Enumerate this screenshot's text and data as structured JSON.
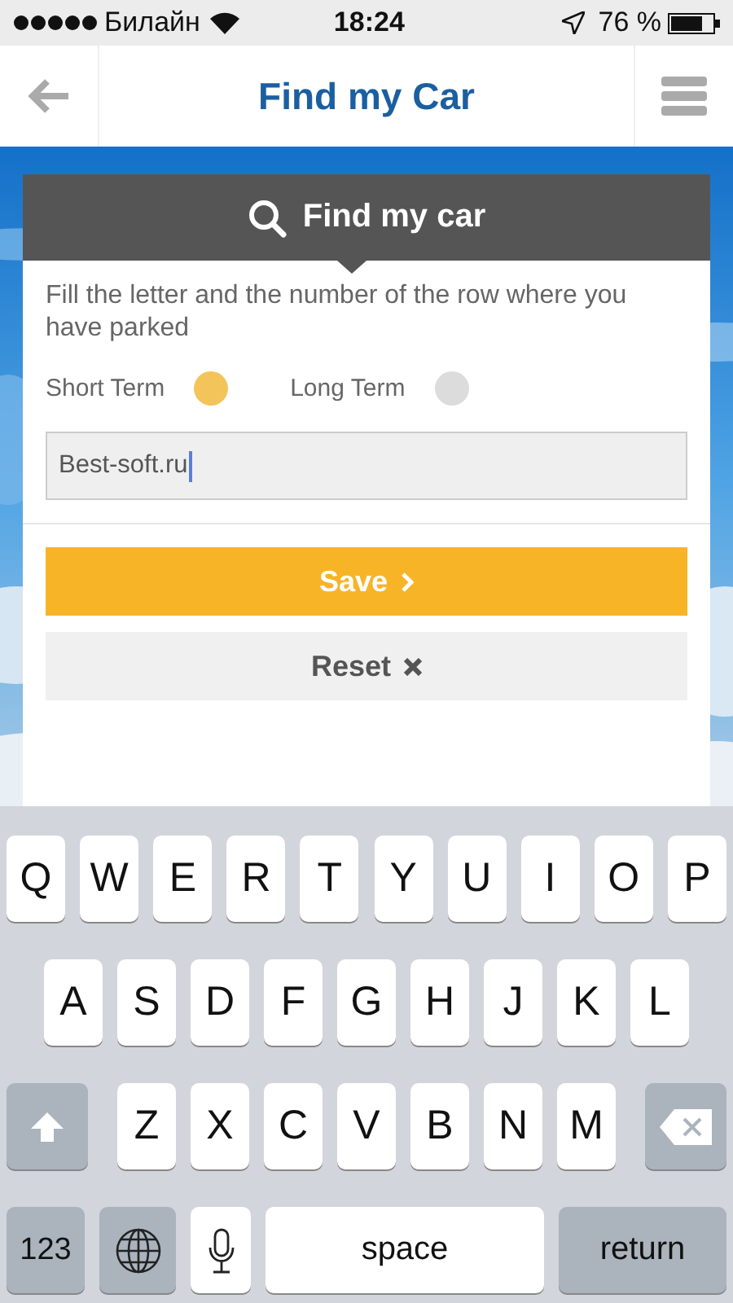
{
  "status_bar": {
    "carrier": "Билайн",
    "time": "18:24",
    "battery": "76 %"
  },
  "nav": {
    "title": "Find my Car"
  },
  "card": {
    "title": "Find my car",
    "instruction": "Fill the letter and the number of the row where you have parked",
    "options": [
      {
        "label": "Short Term",
        "selected": true
      },
      {
        "label": "Long Term",
        "selected": false
      }
    ],
    "input": {
      "value": "Best-soft.ru"
    },
    "buttons": [
      {
        "kind": "primary",
        "label": "Save"
      },
      {
        "kind": "secondary",
        "label": "Reset"
      }
    ]
  },
  "keyboard": {
    "rows": [
      [
        {
          "kind": "letter",
          "label": "Q"
        },
        {
          "kind": "letter",
          "label": "W"
        },
        {
          "kind": "letter",
          "label": "E"
        },
        {
          "kind": "letter",
          "label": "R"
        },
        {
          "kind": "letter",
          "label": "T"
        },
        {
          "kind": "letter",
          "label": "Y"
        },
        {
          "kind": "letter",
          "label": "U"
        },
        {
          "kind": "letter",
          "label": "I"
        },
        {
          "kind": "letter",
          "label": "O"
        },
        {
          "kind": "letter",
          "label": "P"
        }
      ],
      [
        {
          "kind": "letter",
          "label": "A"
        },
        {
          "kind": "letter",
          "label": "S"
        },
        {
          "kind": "letter",
          "label": "D"
        },
        {
          "kind": "letter",
          "label": "F"
        },
        {
          "kind": "letter",
          "label": "G"
        },
        {
          "kind": "letter",
          "label": "H"
        },
        {
          "kind": "letter",
          "label": "J"
        },
        {
          "kind": "letter",
          "label": "K"
        },
        {
          "kind": "letter",
          "label": "L"
        }
      ],
      [
        {
          "kind": "shift"
        },
        {
          "kind": "letter",
          "label": "Z"
        },
        {
          "kind": "letter",
          "label": "X"
        },
        {
          "kind": "letter",
          "label": "C"
        },
        {
          "kind": "letter",
          "label": "V"
        },
        {
          "kind": "letter",
          "label": "B"
        },
        {
          "kind": "letter",
          "label": "N"
        },
        {
          "kind": "letter",
          "label": "M"
        },
        {
          "kind": "delete"
        }
      ]
    ],
    "bottom_bar": {
      "numbers_key": "123",
      "space_key": "space",
      "return_key": "return"
    }
  }
}
